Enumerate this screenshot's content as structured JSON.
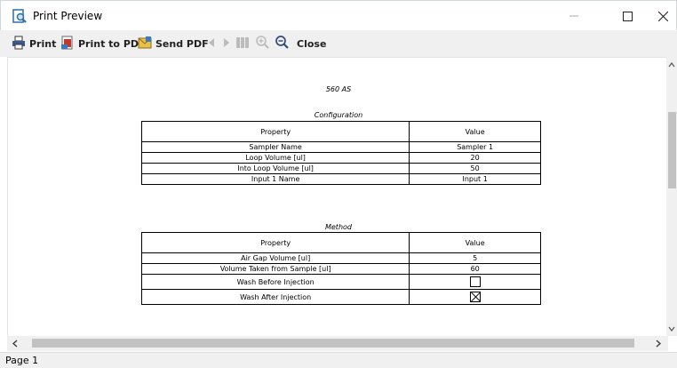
{
  "window": {
    "title": "Print Preview"
  },
  "toolbar": {
    "print_label": "Print",
    "print_pdf_label": "Print to PDF",
    "send_pdf_label": "Send PDF",
    "close_label": "Close"
  },
  "document": {
    "title": "560 AS",
    "configuration": {
      "caption": "Configuration",
      "header_property": "Property",
      "header_value": "Value",
      "rows": [
        {
          "property": "Sampler Name",
          "value": "Sampler 1"
        },
        {
          "property": "Loop Volume [ul]",
          "value": "20"
        },
        {
          "property": "Into Loop Volume [ul]",
          "value": "50"
        },
        {
          "property": "Input 1 Name",
          "value": "Input 1"
        }
      ]
    },
    "method": {
      "caption": "Method",
      "header_property": "Property",
      "header_value": "Value",
      "rows": [
        {
          "property": "Air Gap Volume [ul]",
          "value": "5"
        },
        {
          "property": "Volume Taken from Sample [ul]",
          "value": "60"
        }
      ],
      "checkbox_rows": [
        {
          "property": "Wash Before Injection",
          "checked": false
        },
        {
          "property": "Wash After Injection",
          "checked": true
        }
      ]
    }
  },
  "status": {
    "page_label": "Page 1"
  },
  "colors": {
    "accent": "#2b6cb0",
    "pdf_red": "#c0392b"
  }
}
